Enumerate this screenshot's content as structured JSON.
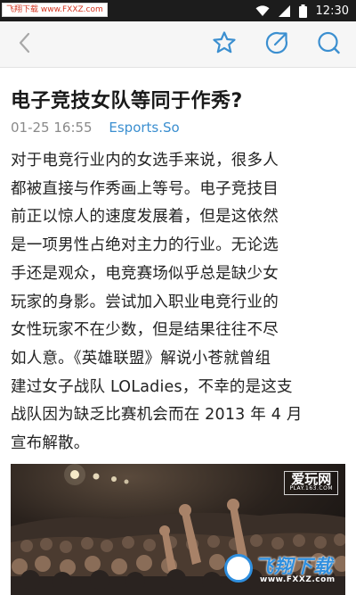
{
  "status_bar": {
    "watermark_badge": "飞翔下载 www.FXXZ.com",
    "time": "12:30",
    "icons": [
      "wifi-icon",
      "signal-icon",
      "battery-icon"
    ]
  },
  "toolbar": {
    "icons": [
      "back-arrow-icon",
      "star-icon",
      "share-icon",
      "comment-icon"
    ],
    "icon_color": "#3b8fd0"
  },
  "article": {
    "title": "电子竞技女队等同于作秀?",
    "time": "01-25 16:55",
    "source": "Esports.So",
    "body_lines": [
      "对于电竞行业内的女选手来说，很多人",
      "都被直接与作秀画上等号。电子竞技目",
      "前正以惊人的速度发展着，但是这依然",
      "是一项男性占绝对主力的行业。无论选",
      "手还是观众，电竞赛场似乎总是缺少女",
      "玩家的身影。尝试加入职业电竞行业的",
      "女性玩家不在少数，但是结果往往不尽",
      "如人意。《英雄联盟》解说小苍就曾组",
      "建过女子战队 LOLadies，不幸的是这支",
      "战队因为缺乏比赛机会而在 2013 年 4 月",
      "宣布解散。"
    ]
  },
  "photo": {
    "logo": "爱玩网",
    "logo_sub": "PLAY.163.COM",
    "site_watermark_name": "飞翔下载",
    "site_watermark_url": "www.FXXZ.com"
  }
}
